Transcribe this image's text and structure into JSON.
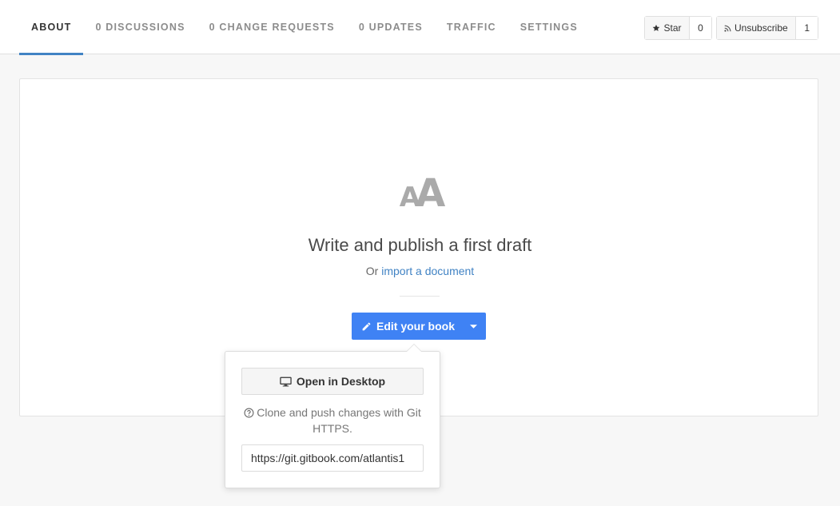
{
  "nav": {
    "tabs": [
      {
        "label": "ABOUT",
        "active": true
      },
      {
        "label": "0 DISCUSSIONS",
        "active": false
      },
      {
        "label": "0 CHANGE REQUESTS",
        "active": false
      },
      {
        "label": "0 UPDATES",
        "active": false
      },
      {
        "label": "TRAFFIC",
        "active": false
      },
      {
        "label": "SETTINGS",
        "active": false
      }
    ],
    "star": {
      "label": "Star",
      "count": "0",
      "icon": "star-icon"
    },
    "unsubscribe": {
      "label": "Unsubscribe",
      "count": "1",
      "icon": "rss-icon"
    }
  },
  "main": {
    "logo_text": "AA",
    "headline": "Write and publish a first draft",
    "sub_prefix": "Or",
    "import_link": "import a document",
    "edit_button": "Edit your book",
    "edit_icon": "pencil-icon",
    "dropdown_icon": "caret-down-icon"
  },
  "popover": {
    "open_desktop": "Open in Desktop",
    "desktop_icon": "monitor-icon",
    "help_icon": "question-circle-icon",
    "clone_text": "Clone and push changes with Git HTTPS.",
    "url_value": "https://git.gitbook.com/atlantis1"
  },
  "colors": {
    "accent_blue": "#3f82f4",
    "link_blue": "#4183c4",
    "tab_underline": "#4183c4",
    "background": "#f7f7f7"
  }
}
